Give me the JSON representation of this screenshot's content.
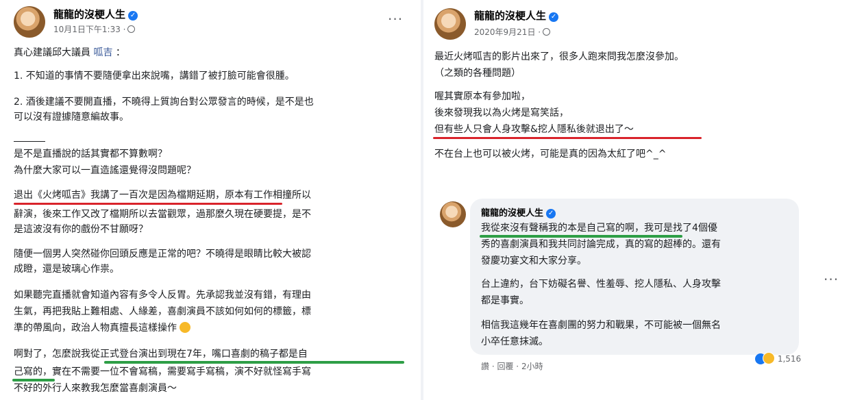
{
  "left_post": {
    "author": "龍龍的沒梗人生",
    "timestamp": "10月1日下午1:33 ·",
    "more": "···",
    "line1_prefix": "真心建議邱大議員",
    "line1_link": "呱吉",
    "line1_suffix": "：",
    "p1": "1. 不知道的事情不要隨便拿出來說嘴，講錯了被打臉可能會很腫。",
    "p2a": "2. 酒後建議不要開直播，不曉得上質詢台對公眾發言的時候，是不是也",
    "p2b": "可以沒有證據隨意編故事。",
    "q1": "是不是直播說的話其實都不算數啊？",
    "q2": "為什麼大家可以一直造謠還覺得沒問題呢？",
    "r1": "退出《火烤呱吉》我講了一百次是因為檔期延期，原本有工作相撞所以",
    "r2": "辭演，後來工作又改了檔期所以去當觀眾，過那麼久現在硬要提，是不",
    "r3": "是這波沒有你的戲份不甘願呀？",
    "s1": "隨便一個男人突然碰你回頭反應是正常的吧？不曉得是眼睛比較大被認",
    "s2": "成瞪，還是玻璃心作祟。",
    "t1": "如果聽完直播就會知道內容有多令人反胃。先承認我並沒有錯，有理由",
    "t2": "生氣，再把我貼上難相處、人緣差，喜劇演員不該如何如何的標籤，標",
    "t3": "準的帶風向，政治人物真擅長這樣操作",
    "u1": "啊對了，怎麼說我從正式登台演出到現在7年，嘴口喜劇的稿子都是自",
    "u2": "己寫的，實在不需要一位不會寫稿，需要寫手寫稿，演不好就怪寫手寫",
    "u3": "不好的外行人來教我怎麼當喜劇演員～"
  },
  "right_post": {
    "author": "龍龍的沒梗人生",
    "timestamp": "2020年9月21日 ·",
    "l1": "最近火烤呱吉的影片出來了，很多人跑來問我怎麼沒參加。",
    "l2": "（之類的各種問題）",
    "l3": "喔其實原本有參加啦，",
    "l4": "後來發現我以為火烤是寫笑話，",
    "l5": "但有些人只會人身攻擊&挖人隱私後就退出了～",
    "l6": "不在台上也可以被火烤，可能是真的因為太紅了吧^_^"
  },
  "comment": {
    "author": "龍龍的沒梗人生",
    "c1": "我從來沒有聲稱我的本是自己寫的啊，我可是找了4個優",
    "c2": "秀的喜劇演員和我共同討論完成，真的寫的超棒的。還有",
    "c3": "發慶功宴文和大家分享。",
    "c4": "台上違約，台下妨礙名譽、性羞辱、挖人隱私、人身攻擊",
    "c5": "都是事實。",
    "c6": "相信我這幾年在喜劇團的努力和戰果，不可能被一個無名",
    "c7": "小卒任意抹滅。",
    "like": "讚",
    "reply": "回覆",
    "time": "2小時",
    "reaction_count": "1,516",
    "more": "···"
  },
  "colors": {
    "verified": "#1877f2",
    "underline_red": "#d9232b",
    "underline_green": "#2e9e46"
  }
}
